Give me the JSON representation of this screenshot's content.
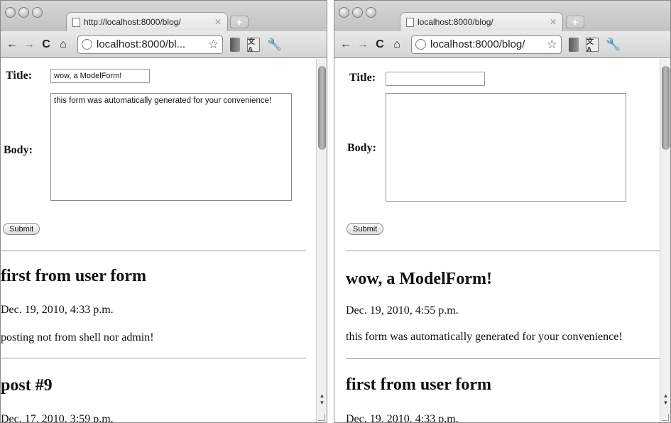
{
  "left": {
    "tab_title": "http://localhost:8000/blog/",
    "url": "localhost:8000/bl...",
    "form": {
      "title_label": "Title:",
      "title_value": "wow, a ModelForm!",
      "body_label": "Body:",
      "body_value": "this form was automatically generated for your convenience!",
      "submit_label": "Submit"
    },
    "posts": [
      {
        "title": "first from user form",
        "date": "Dec. 19, 2010, 4:33 p.m.",
        "body": "posting not from shell nor admin!"
      },
      {
        "title": "post #9",
        "date": "Dec. 17, 2010, 3:59 p.m."
      }
    ]
  },
  "right": {
    "tab_title": "localhost:8000/blog/",
    "url": "localhost:8000/blog/",
    "form": {
      "title_label": "Title:",
      "title_value": "",
      "body_label": "Body:",
      "body_value": "",
      "submit_label": "Submit"
    },
    "posts": [
      {
        "title": "wow, a ModelForm!",
        "date": "Dec. 19, 2010, 4:55 p.m.",
        "body": "this form was automatically generated for your convenience!"
      },
      {
        "title": "first from user form",
        "date": "Dec. 19, 2010, 4:33 p.m."
      }
    ]
  },
  "toolbar": {
    "back": "←",
    "forward": "→",
    "reload": "C",
    "home": "⌂",
    "star": "☆",
    "wrench": "🔧",
    "translate": "文A"
  },
  "icons": [
    "back-icon",
    "forward-icon",
    "reload-icon",
    "home-icon",
    "globe-icon",
    "star-icon",
    "book-icon",
    "translate-icon",
    "wrench-icon",
    "document-icon",
    "close-icon"
  ]
}
